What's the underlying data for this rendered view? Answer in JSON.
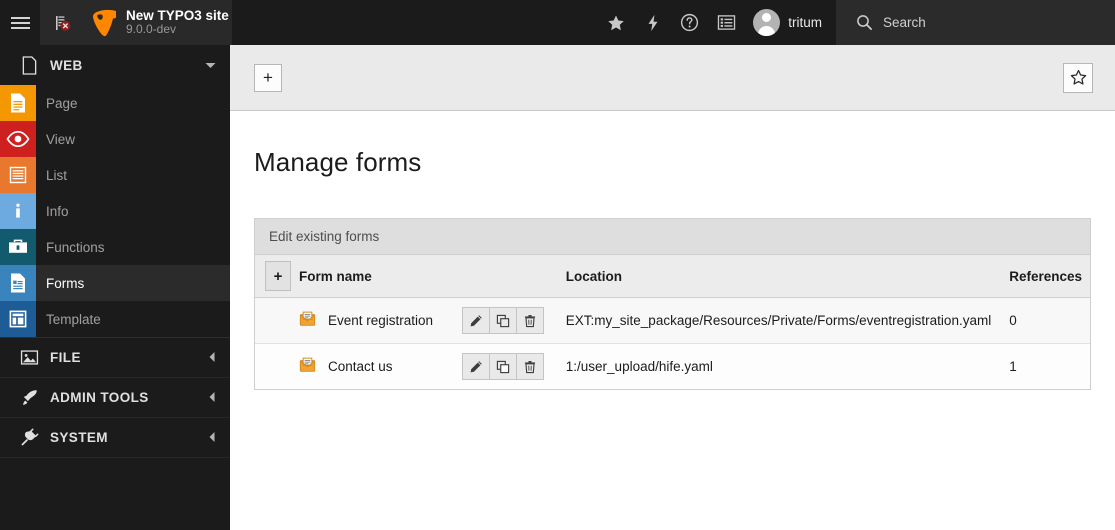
{
  "topbar": {
    "menu_icon": "hamburger-icon",
    "cache_icon": "clear-cache-icon",
    "site_name": "New TYPO3 site",
    "site_version": "9.0.0-dev",
    "icons": [
      {
        "name": "bookmark-star-icon",
        "glyph": "star"
      },
      {
        "name": "flash-messages-icon",
        "glyph": "bolt"
      },
      {
        "name": "help-icon",
        "glyph": "question"
      },
      {
        "name": "open-documents-icon",
        "glyph": "list"
      }
    ],
    "username": "tritum",
    "search_label": "Search",
    "search_placeholder": "Search"
  },
  "sidebar": {
    "sections": [
      {
        "label": "WEB",
        "icon": "page-doc-icon",
        "expanded": true,
        "chevron": "chevron-down-icon",
        "items": [
          {
            "label": "Page",
            "icon": "page-icon",
            "color": "#f49700",
            "active": false
          },
          {
            "label": "View",
            "icon": "view-eye-icon",
            "color": "#cd201f",
            "active": false
          },
          {
            "label": "List",
            "icon": "list-icon",
            "color": "#e8782d",
            "active": false
          },
          {
            "label": "Info",
            "icon": "info-icon",
            "color": "#6daae0",
            "active": false
          },
          {
            "label": "Functions",
            "icon": "functions-icon",
            "color": "#125b6e",
            "active": false
          },
          {
            "label": "Forms",
            "icon": "forms-icon",
            "color": "#3a84bd",
            "active": true
          },
          {
            "label": "Template",
            "icon": "template-icon",
            "color": "#1d5c96",
            "active": false
          }
        ]
      },
      {
        "label": "FILE",
        "icon": "file-image-icon",
        "expanded": false,
        "chevron": "chevron-left-icon",
        "items": []
      },
      {
        "label": "ADMIN TOOLS",
        "icon": "rocket-icon",
        "expanded": false,
        "chevron": "chevron-left-icon",
        "items": []
      },
      {
        "label": "SYSTEM",
        "icon": "plug-icon",
        "expanded": false,
        "chevron": "chevron-left-icon",
        "items": []
      }
    ]
  },
  "docheader": {
    "new_button_label": "+",
    "new_button_icon": "plus-icon",
    "bookmark_icon": "bookmark-star-outline-icon"
  },
  "main": {
    "page_title": "Manage forms",
    "panel": {
      "heading": "Edit existing forms",
      "create_button_label": "+",
      "create_button_icon": "plus-icon",
      "columns": {
        "name": "Form name",
        "location": "Location",
        "references": "References"
      },
      "row_actions": [
        {
          "name": "edit-form-button",
          "icon": "pencil-icon"
        },
        {
          "name": "duplicate-form-button",
          "icon": "duplicate-icon"
        },
        {
          "name": "delete-form-button",
          "icon": "trash-icon"
        }
      ],
      "rows": [
        {
          "icon": "form-envelope-icon",
          "name": "Event registration",
          "location": "EXT:my_site_package/Resources/Private/Forms/eventregistration.yaml",
          "references": "0"
        },
        {
          "icon": "form-envelope-icon",
          "name": "Contact us",
          "location": "1:/user_upload/hife.yaml",
          "references": "1"
        }
      ]
    }
  },
  "colors": {
    "topbar_bg": "#1b1b1b",
    "sidebar_bg": "#1b1b1b",
    "active_item_bg": "#2b2b2b",
    "docheader_bg": "#eaeaea",
    "panel_head_bg": "#dedede",
    "typo3_orange": "#ff8700"
  }
}
